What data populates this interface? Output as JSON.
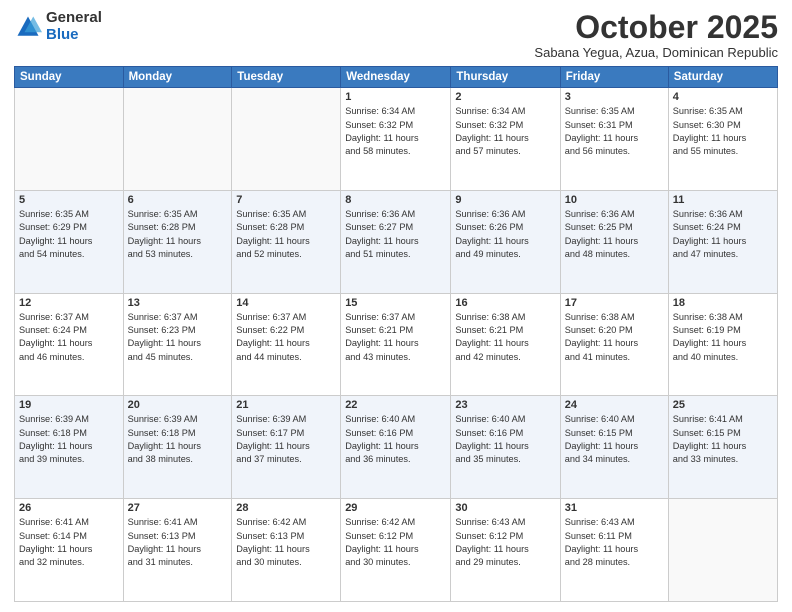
{
  "header": {
    "logo_general": "General",
    "logo_blue": "Blue",
    "month_title": "October 2025",
    "location": "Sabana Yegua, Azua, Dominican Republic"
  },
  "weekdays": [
    "Sunday",
    "Monday",
    "Tuesday",
    "Wednesday",
    "Thursday",
    "Friday",
    "Saturday"
  ],
  "weeks": [
    [
      {
        "day": "",
        "info": ""
      },
      {
        "day": "",
        "info": ""
      },
      {
        "day": "",
        "info": ""
      },
      {
        "day": "1",
        "info": "Sunrise: 6:34 AM\nSunset: 6:32 PM\nDaylight: 11 hours\nand 58 minutes."
      },
      {
        "day": "2",
        "info": "Sunrise: 6:34 AM\nSunset: 6:32 PM\nDaylight: 11 hours\nand 57 minutes."
      },
      {
        "day": "3",
        "info": "Sunrise: 6:35 AM\nSunset: 6:31 PM\nDaylight: 11 hours\nand 56 minutes."
      },
      {
        "day": "4",
        "info": "Sunrise: 6:35 AM\nSunset: 6:30 PM\nDaylight: 11 hours\nand 55 minutes."
      }
    ],
    [
      {
        "day": "5",
        "info": "Sunrise: 6:35 AM\nSunset: 6:29 PM\nDaylight: 11 hours\nand 54 minutes."
      },
      {
        "day": "6",
        "info": "Sunrise: 6:35 AM\nSunset: 6:28 PM\nDaylight: 11 hours\nand 53 minutes."
      },
      {
        "day": "7",
        "info": "Sunrise: 6:35 AM\nSunset: 6:28 PM\nDaylight: 11 hours\nand 52 minutes."
      },
      {
        "day": "8",
        "info": "Sunrise: 6:36 AM\nSunset: 6:27 PM\nDaylight: 11 hours\nand 51 minutes."
      },
      {
        "day": "9",
        "info": "Sunrise: 6:36 AM\nSunset: 6:26 PM\nDaylight: 11 hours\nand 49 minutes."
      },
      {
        "day": "10",
        "info": "Sunrise: 6:36 AM\nSunset: 6:25 PM\nDaylight: 11 hours\nand 48 minutes."
      },
      {
        "day": "11",
        "info": "Sunrise: 6:36 AM\nSunset: 6:24 PM\nDaylight: 11 hours\nand 47 minutes."
      }
    ],
    [
      {
        "day": "12",
        "info": "Sunrise: 6:37 AM\nSunset: 6:24 PM\nDaylight: 11 hours\nand 46 minutes."
      },
      {
        "day": "13",
        "info": "Sunrise: 6:37 AM\nSunset: 6:23 PM\nDaylight: 11 hours\nand 45 minutes."
      },
      {
        "day": "14",
        "info": "Sunrise: 6:37 AM\nSunset: 6:22 PM\nDaylight: 11 hours\nand 44 minutes."
      },
      {
        "day": "15",
        "info": "Sunrise: 6:37 AM\nSunset: 6:21 PM\nDaylight: 11 hours\nand 43 minutes."
      },
      {
        "day": "16",
        "info": "Sunrise: 6:38 AM\nSunset: 6:21 PM\nDaylight: 11 hours\nand 42 minutes."
      },
      {
        "day": "17",
        "info": "Sunrise: 6:38 AM\nSunset: 6:20 PM\nDaylight: 11 hours\nand 41 minutes."
      },
      {
        "day": "18",
        "info": "Sunrise: 6:38 AM\nSunset: 6:19 PM\nDaylight: 11 hours\nand 40 minutes."
      }
    ],
    [
      {
        "day": "19",
        "info": "Sunrise: 6:39 AM\nSunset: 6:18 PM\nDaylight: 11 hours\nand 39 minutes."
      },
      {
        "day": "20",
        "info": "Sunrise: 6:39 AM\nSunset: 6:18 PM\nDaylight: 11 hours\nand 38 minutes."
      },
      {
        "day": "21",
        "info": "Sunrise: 6:39 AM\nSunset: 6:17 PM\nDaylight: 11 hours\nand 37 minutes."
      },
      {
        "day": "22",
        "info": "Sunrise: 6:40 AM\nSunset: 6:16 PM\nDaylight: 11 hours\nand 36 minutes."
      },
      {
        "day": "23",
        "info": "Sunrise: 6:40 AM\nSunset: 6:16 PM\nDaylight: 11 hours\nand 35 minutes."
      },
      {
        "day": "24",
        "info": "Sunrise: 6:40 AM\nSunset: 6:15 PM\nDaylight: 11 hours\nand 34 minutes."
      },
      {
        "day": "25",
        "info": "Sunrise: 6:41 AM\nSunset: 6:15 PM\nDaylight: 11 hours\nand 33 minutes."
      }
    ],
    [
      {
        "day": "26",
        "info": "Sunrise: 6:41 AM\nSunset: 6:14 PM\nDaylight: 11 hours\nand 32 minutes."
      },
      {
        "day": "27",
        "info": "Sunrise: 6:41 AM\nSunset: 6:13 PM\nDaylight: 11 hours\nand 31 minutes."
      },
      {
        "day": "28",
        "info": "Sunrise: 6:42 AM\nSunset: 6:13 PM\nDaylight: 11 hours\nand 30 minutes."
      },
      {
        "day": "29",
        "info": "Sunrise: 6:42 AM\nSunset: 6:12 PM\nDaylight: 11 hours\nand 30 minutes."
      },
      {
        "day": "30",
        "info": "Sunrise: 6:43 AM\nSunset: 6:12 PM\nDaylight: 11 hours\nand 29 minutes."
      },
      {
        "day": "31",
        "info": "Sunrise: 6:43 AM\nSunset: 6:11 PM\nDaylight: 11 hours\nand 28 minutes."
      },
      {
        "day": "",
        "info": ""
      }
    ]
  ]
}
